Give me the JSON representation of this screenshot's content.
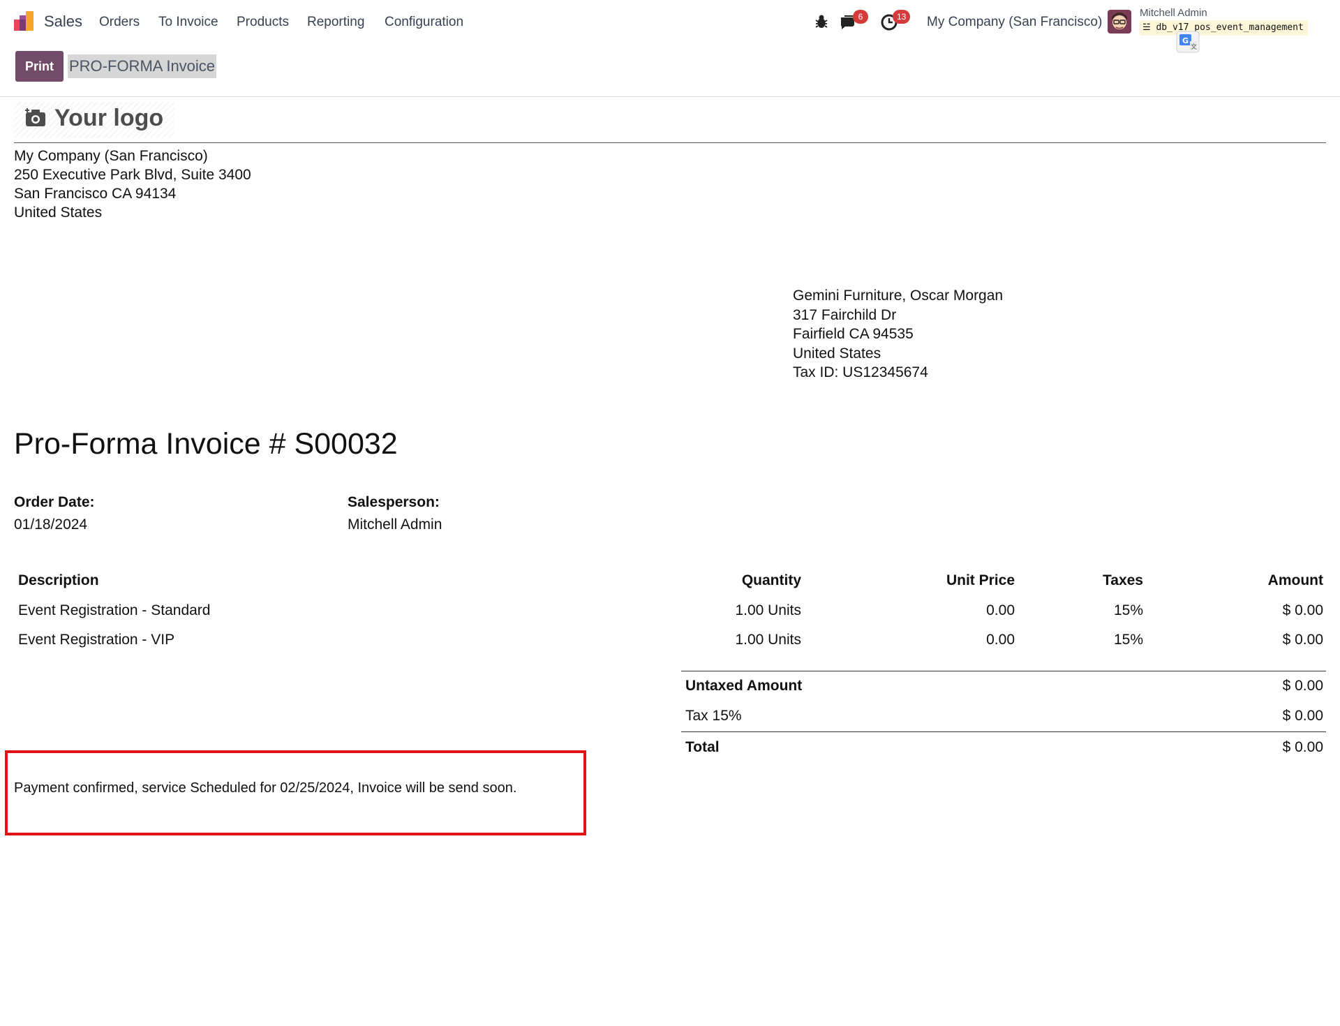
{
  "navbar": {
    "app_name": "Sales",
    "menu": [
      "Orders",
      "To Invoice",
      "Products",
      "Reporting",
      "Configuration"
    ],
    "messages_count": "6",
    "activities_count": "13",
    "company": "My Company (San Francisco)",
    "user_name": "Mitchell Admin",
    "database": "db_v17_pos_event_management",
    "icons": [
      "bug-icon",
      "chat-icon",
      "clock-icon",
      "translate-icon"
    ]
  },
  "controls": {
    "print_label": "Print",
    "report_name": "PRO-FORMA Invoice"
  },
  "report": {
    "logo_text": "Your logo",
    "company_address": [
      "My Company (San Francisco)",
      "250 Executive Park Blvd, Suite 3400",
      "San Francisco CA 94134",
      "United States"
    ],
    "customer_address": [
      "Gemini Furniture, Oscar Morgan",
      "317 Fairchild Dr",
      "Fairfield CA 94535",
      "United States",
      "Tax ID: US12345674"
    ],
    "title": "Pro-Forma Invoice # S00032",
    "order_date_label": "Order Date:",
    "order_date": "01/18/2024",
    "salesperson_label": "Salesperson:",
    "salesperson": "Mitchell Admin",
    "columns": [
      "Description",
      "Quantity",
      "Unit Price",
      "Taxes",
      "Amount"
    ],
    "lines": [
      {
        "description": "Event Registration - Standard",
        "quantity": "1.00 Units",
        "unit_price": "0.00",
        "taxes": "15%",
        "amount": "$ 0.00"
      },
      {
        "description": "Event Registration - VIP",
        "quantity": "1.00 Units",
        "unit_price": "0.00",
        "taxes": "15%",
        "amount": "$ 0.00"
      }
    ],
    "untaxed_label": "Untaxed Amount",
    "untaxed_value": "$ 0.00",
    "tax_label": "Tax 15%",
    "tax_value": "$ 0.00",
    "total_label": "Total",
    "total_value": "$ 0.00",
    "note": "Payment confirmed, service Scheduled for 02/25/2024, Invoice will be send soon."
  },
  "colors": {
    "brand": "#714b67",
    "highlight_border": "#e41212",
    "badge": "#d63b3b"
  }
}
